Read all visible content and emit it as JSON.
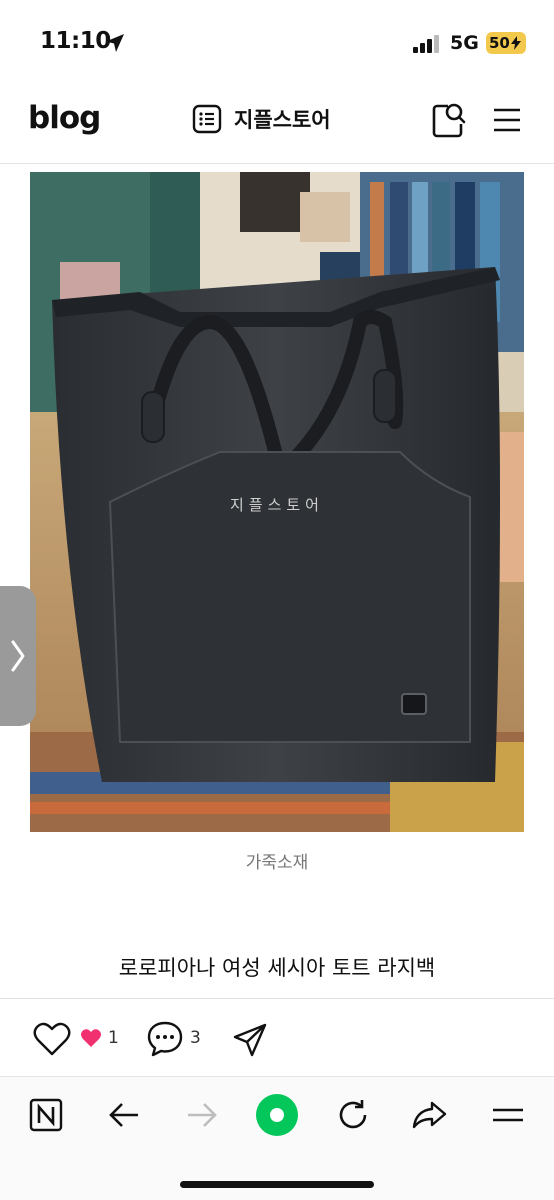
{
  "status_bar": {
    "time": "11:10",
    "network": "5G",
    "battery": "50"
  },
  "header": {
    "logo": "blog",
    "blog_name": "지플스토어"
  },
  "post": {
    "watermark": "지플스토어",
    "caption": "가죽소재",
    "title": "로로피아나 여성 세시아 토트 라지백"
  },
  "actions": {
    "like_count": "1",
    "comment_count": "3"
  },
  "icons": {
    "status": [
      "location-arrow-icon",
      "signal-bars-icon",
      "bolt-icon"
    ],
    "header": [
      "list-icon",
      "search-icon",
      "menu-icon"
    ],
    "actions": [
      "heart-icon",
      "comment-icon",
      "share-icon"
    ],
    "nav": [
      "naver-home-icon",
      "back-arrow-icon",
      "forward-arrow-icon",
      "green-dot-icon",
      "refresh-icon",
      "share-arrow-icon",
      "tab-menu-icon"
    ]
  },
  "colors": {
    "accent_green": "#03c75a",
    "heart_pink": "#f0306f",
    "battery_yellow": "#f2c94c"
  }
}
